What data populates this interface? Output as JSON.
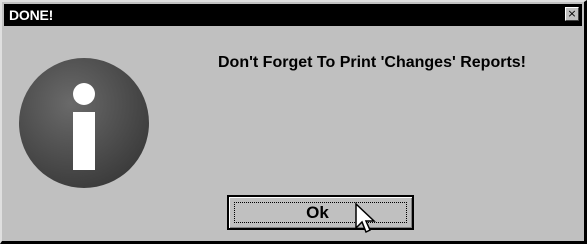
{
  "window": {
    "title": "DONE!",
    "close_glyph": "×"
  },
  "dialog": {
    "message": "Don't Forget To Print 'Changes' Reports!",
    "icon": "info-icon",
    "icon_letter": "i"
  },
  "buttons": {
    "ok_label": "Ok"
  },
  "colors": {
    "titlebar": "#000000",
    "dialog_bg": "#c0c0c0",
    "icon_circle": "#555555",
    "icon_letter": "#ffffff"
  }
}
